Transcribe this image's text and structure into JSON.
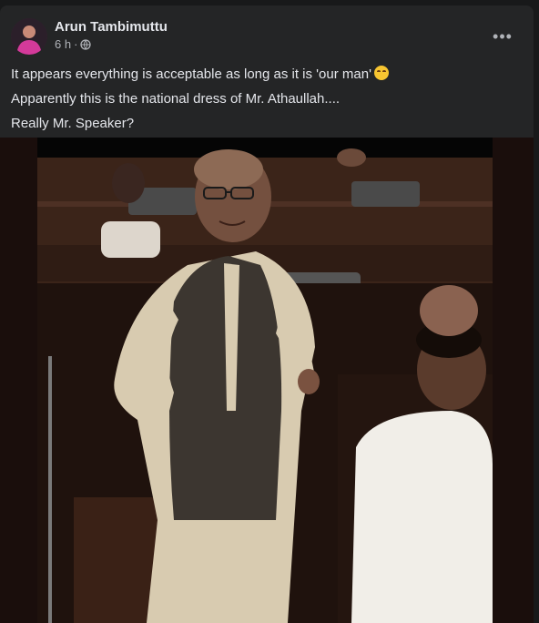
{
  "post": {
    "author": "Arun Tambimuttu",
    "time": "6 h",
    "separator": "·",
    "privacy_icon": "globe-icon",
    "more_icon": "more-options-icon",
    "lines": [
      "It appears everything is acceptable as long as it is 'our man'",
      "Apparently this is the national dress of Mr. Athaullah....",
      "Really Mr. Speaker?"
    ],
    "emoji": "smiling-face-emoji"
  },
  "colors": {
    "card_bg": "#242526",
    "page_bg": "#18191a",
    "text_primary": "#e4e6eb",
    "text_secondary": "#b0b3b8"
  }
}
